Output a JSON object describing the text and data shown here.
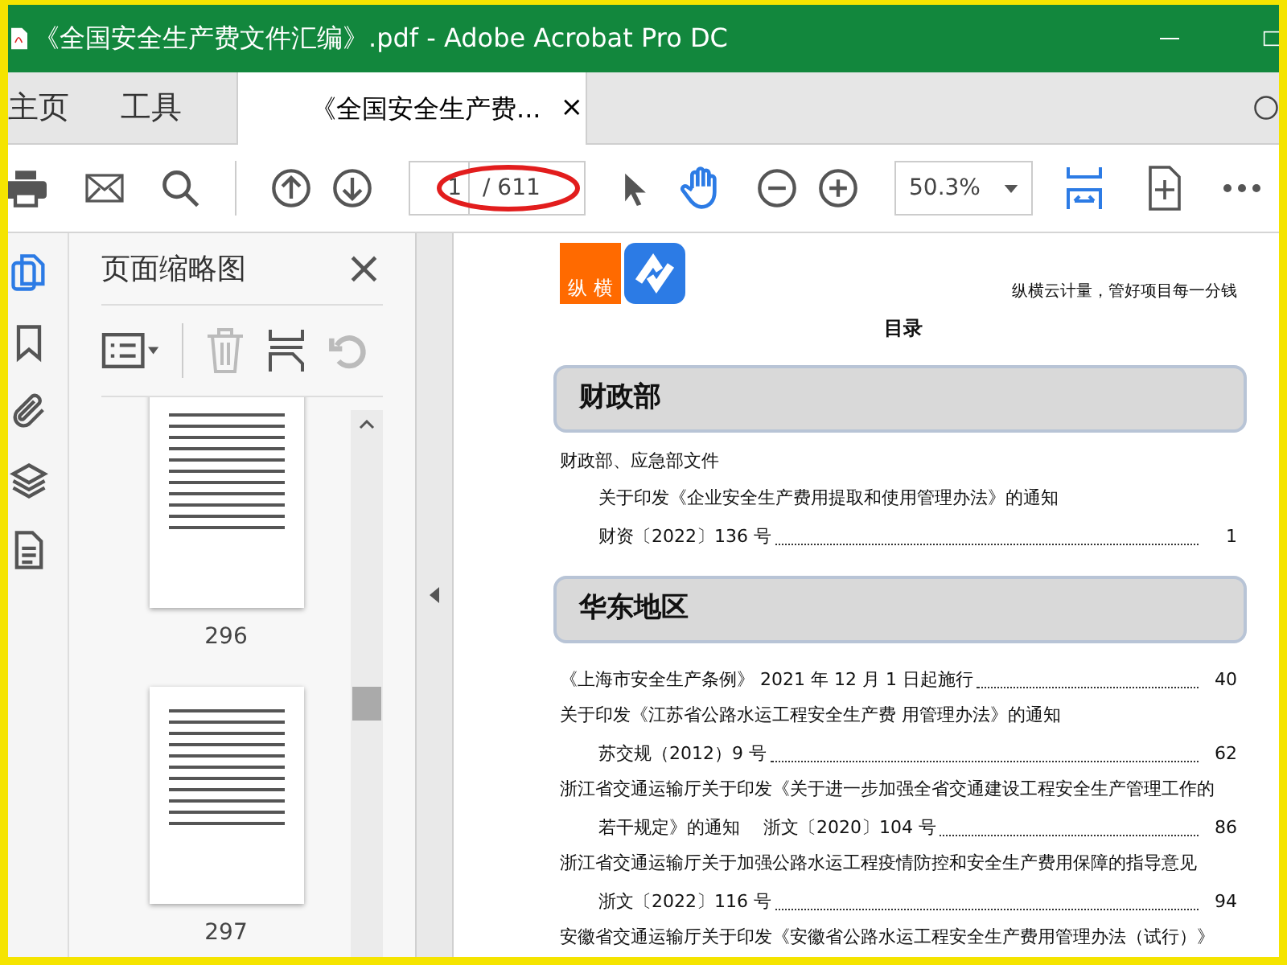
{
  "window": {
    "title": "《全国安全生产费文件汇编》.pdf - Adobe Acrobat Pro DC"
  },
  "nav_tabs": [
    {
      "label": "主页",
      "selected": false
    },
    {
      "label": "工具",
      "selected": false
    }
  ],
  "document_tab": {
    "label": "《全国安全生产费...",
    "close": "×",
    "selected": true
  },
  "toolbar": {
    "page_input": "1",
    "page_total": "/ 611",
    "zoom": "50.3%",
    "hand_tool_active": true
  },
  "sidebar": {
    "items": [
      {
        "kind": "pages",
        "selected": true
      },
      {
        "kind": "bookmark",
        "selected": false
      },
      {
        "kind": "attachment",
        "selected": false
      },
      {
        "kind": "layers",
        "selected": false
      },
      {
        "kind": "content",
        "selected": false
      }
    ]
  },
  "thumbnail_panel": {
    "title": "页面缩略图",
    "close": "×",
    "pages": [
      {
        "label": "296"
      },
      {
        "label": "297"
      }
    ]
  },
  "document": {
    "logo_text": "纵 横",
    "slogan": "纵横云计量，管好项目每一分钱",
    "heading": "目录",
    "sections": [
      {
        "title": "财政部",
        "entries": [
          {
            "kind": "plain",
            "text": "财政部、应急部文件"
          },
          {
            "kind": "indent",
            "text": "关于印发《企业安全生产费用提取和使用管理办法》的通知"
          },
          {
            "kind": "dotted",
            "text": "财资〔2022〕136 号",
            "page": "1"
          }
        ]
      },
      {
        "title": "华东地区",
        "entries": [
          {
            "kind": "dotted_top",
            "text": "《上海市安全生产条例》 2021 年 12 月 1 日起施行",
            "page": "40"
          },
          {
            "kind": "plain",
            "text": "关于印发《江苏省公路水运工程安全生产费 用管理办法》的通知"
          },
          {
            "kind": "dotted",
            "text": "苏交规（2012）9 号",
            "page": "62"
          },
          {
            "kind": "plain",
            "text": "浙江省交通运输厅关于印发《关于进一步加强全省交通建设工程安全生产管理工作的"
          },
          {
            "kind": "dotted",
            "text": "若干规定》的通知　 浙文〔2020〕104 号",
            "page": "86"
          },
          {
            "kind": "plain",
            "text": "浙江省交通运输厅关于加强公路水运工程疫情防控和安全生产费用保障的指导意见"
          },
          {
            "kind": "dotted",
            "text": "浙文〔2022〕116 号",
            "page": "94"
          },
          {
            "kind": "plain",
            "text": "安徽省交通运输厅关于印发《安徽省公路水运工程安全生产费用管理办法（试行）》"
          }
        ]
      }
    ]
  }
}
